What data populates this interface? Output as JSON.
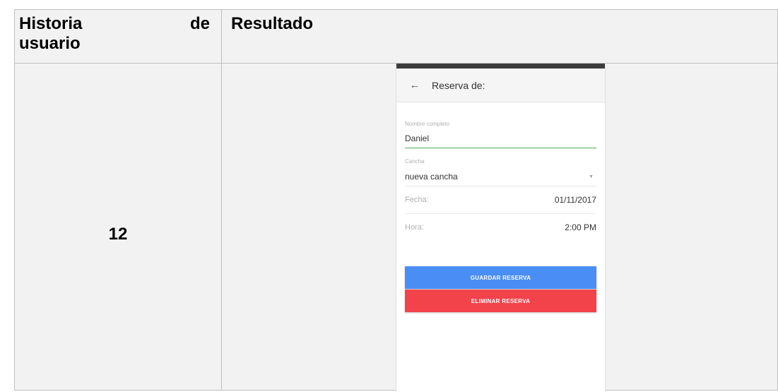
{
  "table": {
    "header": {
      "col1_word1": "Historia",
      "col1_word2": "de",
      "col1_word3": "usuario",
      "col2": "Resultado"
    },
    "row": {
      "story_number": "12"
    }
  },
  "phone": {
    "appbar": {
      "back_icon": "arrow-left-icon",
      "title": "Reserva de:"
    },
    "form": {
      "name_label": "Nombre completo",
      "name_value": "Daniel",
      "court_label": "Cancha",
      "court_value": "nueva cancha",
      "date_label": "Fecha:",
      "date_value": "01/11/2017",
      "time_label": "Hora:",
      "time_value": "2:00 PM"
    },
    "buttons": {
      "save_label": "GUARDAR RESERVA",
      "delete_label": "ELIMINAR RESERVA"
    },
    "colors": {
      "save": "#4a8ef5",
      "delete": "#f2424a",
      "focus_line": "#4caf50"
    }
  }
}
